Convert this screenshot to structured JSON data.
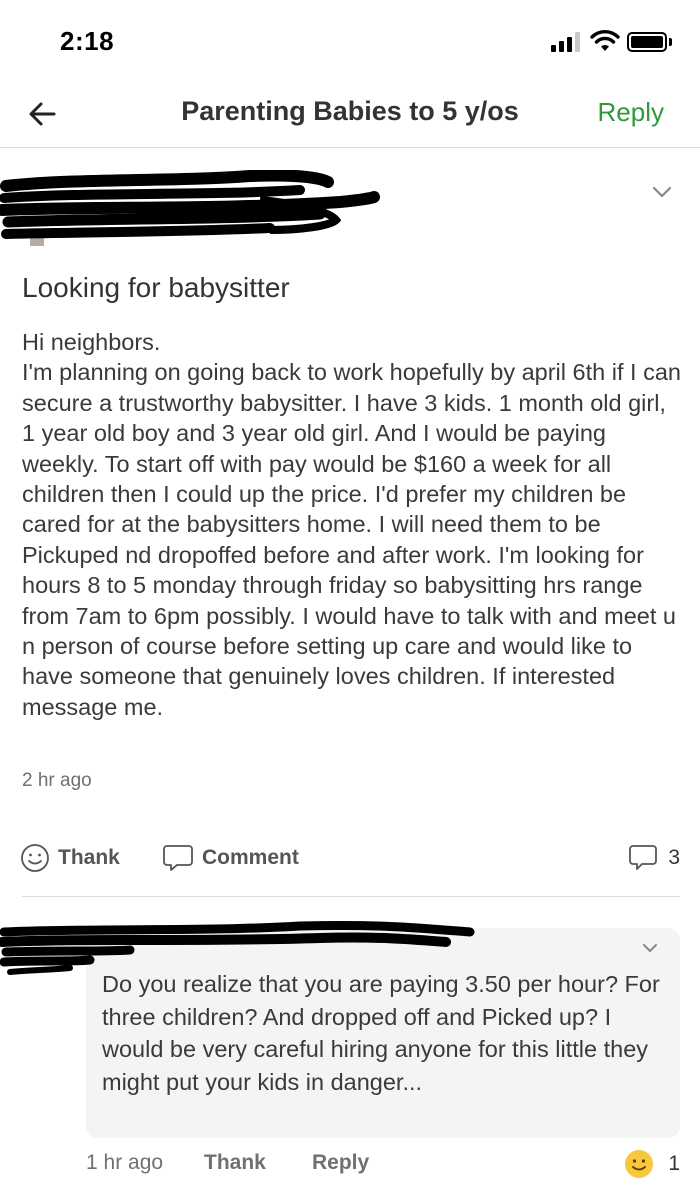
{
  "status_bar": {
    "time": "2:18"
  },
  "nav": {
    "back_icon": "arrow-left-icon",
    "title": "Parenting Babies to 5 y/os",
    "reply_label": "Reply",
    "accent_color": "#2f9a3a"
  },
  "post": {
    "title": "Looking for babysitter",
    "body": "Hi neighbors.\nI'm planning on going back to work hopefully by april 6th if I can secure a trustworthy babysitter. I have 3 kids. 1 month old girl, 1 year old boy and 3 year old girl. And I would be paying weekly. To start off with pay would be $160 a week for all children then I could up the price. I'd prefer my children be cared for at the babysitters home. I will need them to be Pickuped nd dropoffed before and after work. I'm looking for hours 8 to 5 monday through friday so babysitting hrs range from 7am to 6pm possibly. I would have to talk with and meet u n person of course before setting up care and would like to have someone that genuinely loves children. If interested message me.",
    "time": "2 hr ago",
    "actions": {
      "thank_label": "Thank",
      "comment_label": "Comment",
      "comment_count": "3"
    }
  },
  "reply": {
    "text": "Do you realize that you are paying 3.50 per hour?  For three children? And dropped off and Picked up? I would be very careful hiring anyone for this little they might put your kids in danger...",
    "time": "1 hr ago",
    "thank_label": "Thank",
    "reply_label": "Reply",
    "reaction_icon": "smiley-emoji-icon",
    "reaction_count": "1"
  }
}
